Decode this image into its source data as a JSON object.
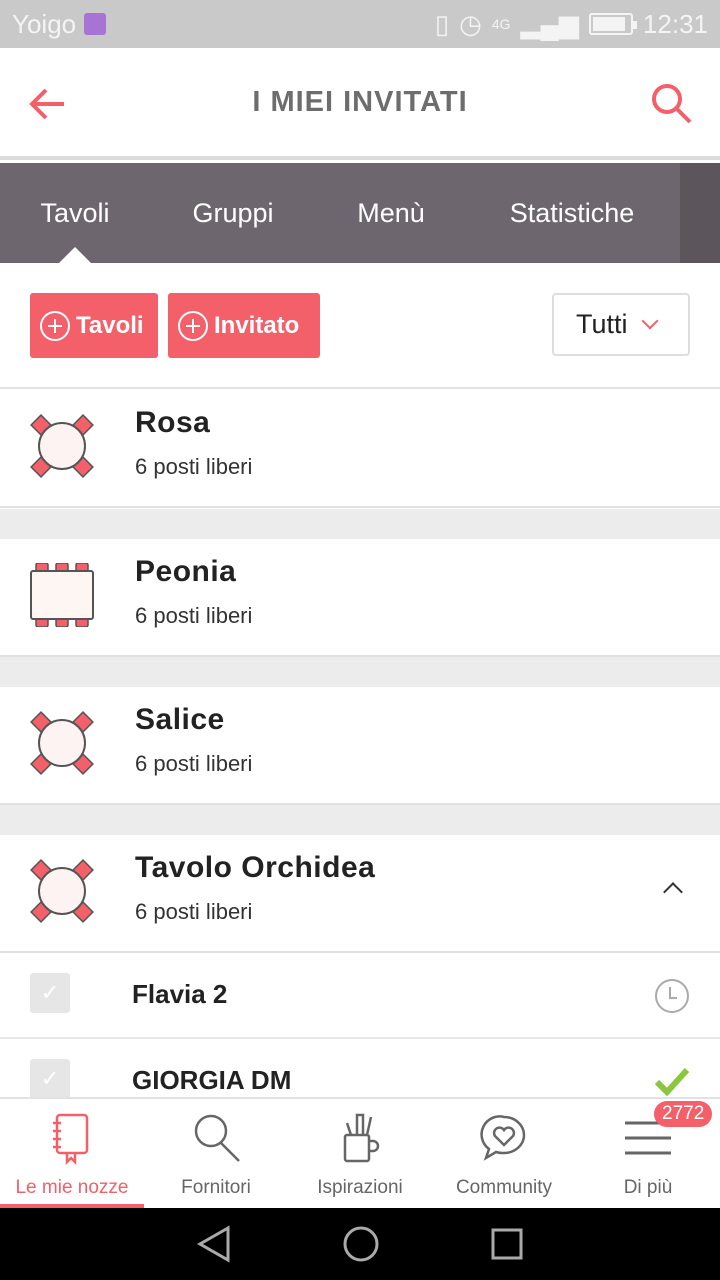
{
  "status_bar": {
    "carrier": "Yoigo",
    "network": "4G",
    "time": "12:31"
  },
  "header": {
    "title": "I MIEI INVITATI",
    "back_icon": "arrow-left-icon",
    "search_icon": "search-icon"
  },
  "tabs": [
    {
      "label": "Tavoli",
      "active": true
    },
    {
      "label": "Gruppi"
    },
    {
      "label": "Menù"
    },
    {
      "label": "Statistiche"
    }
  ],
  "actions": {
    "add_table_label": "Tavoli",
    "add_guest_label": "Invitato",
    "filter": {
      "selected": "Tutti"
    }
  },
  "tables": [
    {
      "name": "Rosa",
      "free_seats": "6 posti liberi",
      "shape": "round"
    },
    {
      "name": "Peonia",
      "free_seats": "6 posti liberi",
      "shape": "rectangular"
    },
    {
      "name": "Salice",
      "free_seats": "6 posti liberi",
      "shape": "round"
    },
    {
      "name": "Tavolo Orchidea",
      "free_seats": "6 posti liberi",
      "shape": "round",
      "expanded": true
    }
  ],
  "guests": [
    {
      "name": "Flavia 2",
      "status": "pending",
      "status_icon": "clock-icon"
    },
    {
      "name": "GIORGIA DM",
      "status": "confirmed",
      "status_icon": "check-icon"
    }
  ],
  "bottom_nav": [
    {
      "label": "Le mie nozze",
      "icon": "notebook-icon",
      "active": true
    },
    {
      "label": "Fornitori",
      "icon": "search-icon"
    },
    {
      "label": "Ispirazioni",
      "icon": "art-supplies-icon"
    },
    {
      "label": "Community",
      "icon": "chat-heart-icon"
    },
    {
      "label": "Di più",
      "icon": "menu-icon",
      "badge": "2772"
    }
  ],
  "colors": {
    "accent": "#f4606a",
    "tab_bar": "#6e666e",
    "confirmed": "#8cc63f"
  }
}
